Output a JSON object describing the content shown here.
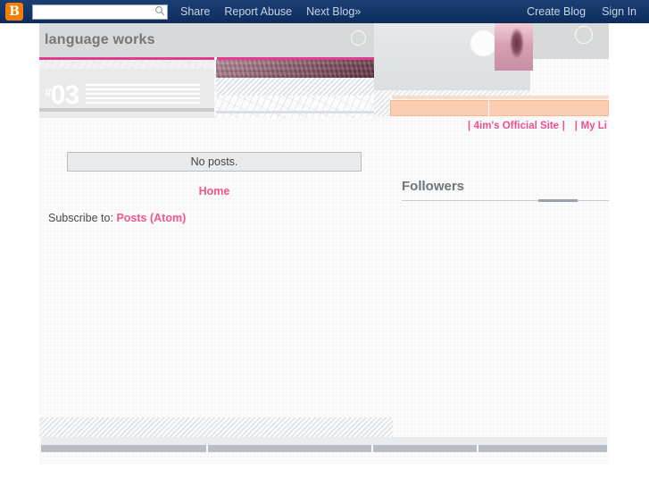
{
  "navbar": {
    "logo_letter": "B",
    "logo_name": "blogger-logo",
    "search": {
      "value": "",
      "placeholder": "",
      "icon": "search-icon"
    },
    "left_links": [
      {
        "label": "Share",
        "name": "share"
      },
      {
        "label": "Report Abuse",
        "name": "report-abuse"
      },
      {
        "label": "Next Blog»",
        "name": "next-blog"
      }
    ],
    "right_links": [
      {
        "label": "Create Blog",
        "name": "create-blog"
      },
      {
        "label": "Sign In",
        "name": "sign-in"
      }
    ]
  },
  "header": {
    "blog_title": "language works",
    "issue_hash": "#",
    "issue_number": "03"
  },
  "site_nav": {
    "items": [
      {
        "label": "4im's Official Site",
        "name": "4ims-official-site"
      },
      {
        "label": "My Li",
        "name": "my-links"
      }
    ],
    "separator": "|"
  },
  "main": {
    "no_posts_text": "No posts.",
    "home_label": "Home",
    "subscribe_prefix": "Subscribe to:",
    "subscribe_link": "Posts (Atom)"
  },
  "sidebar": {
    "followers_title": "Followers"
  },
  "colors": {
    "navbar_bg": "#123366",
    "logo_orange": "#f57d00",
    "accent_pink": "#e23d8f",
    "link_pink": "#f1568f",
    "nav_pink": "#ee4f92",
    "peach": "#fbcdb3",
    "header_grey": "#d8d9da",
    "title_grey": "#767676",
    "followers_grey": "#6f7579",
    "page_bg": "#fbfbfb"
  }
}
